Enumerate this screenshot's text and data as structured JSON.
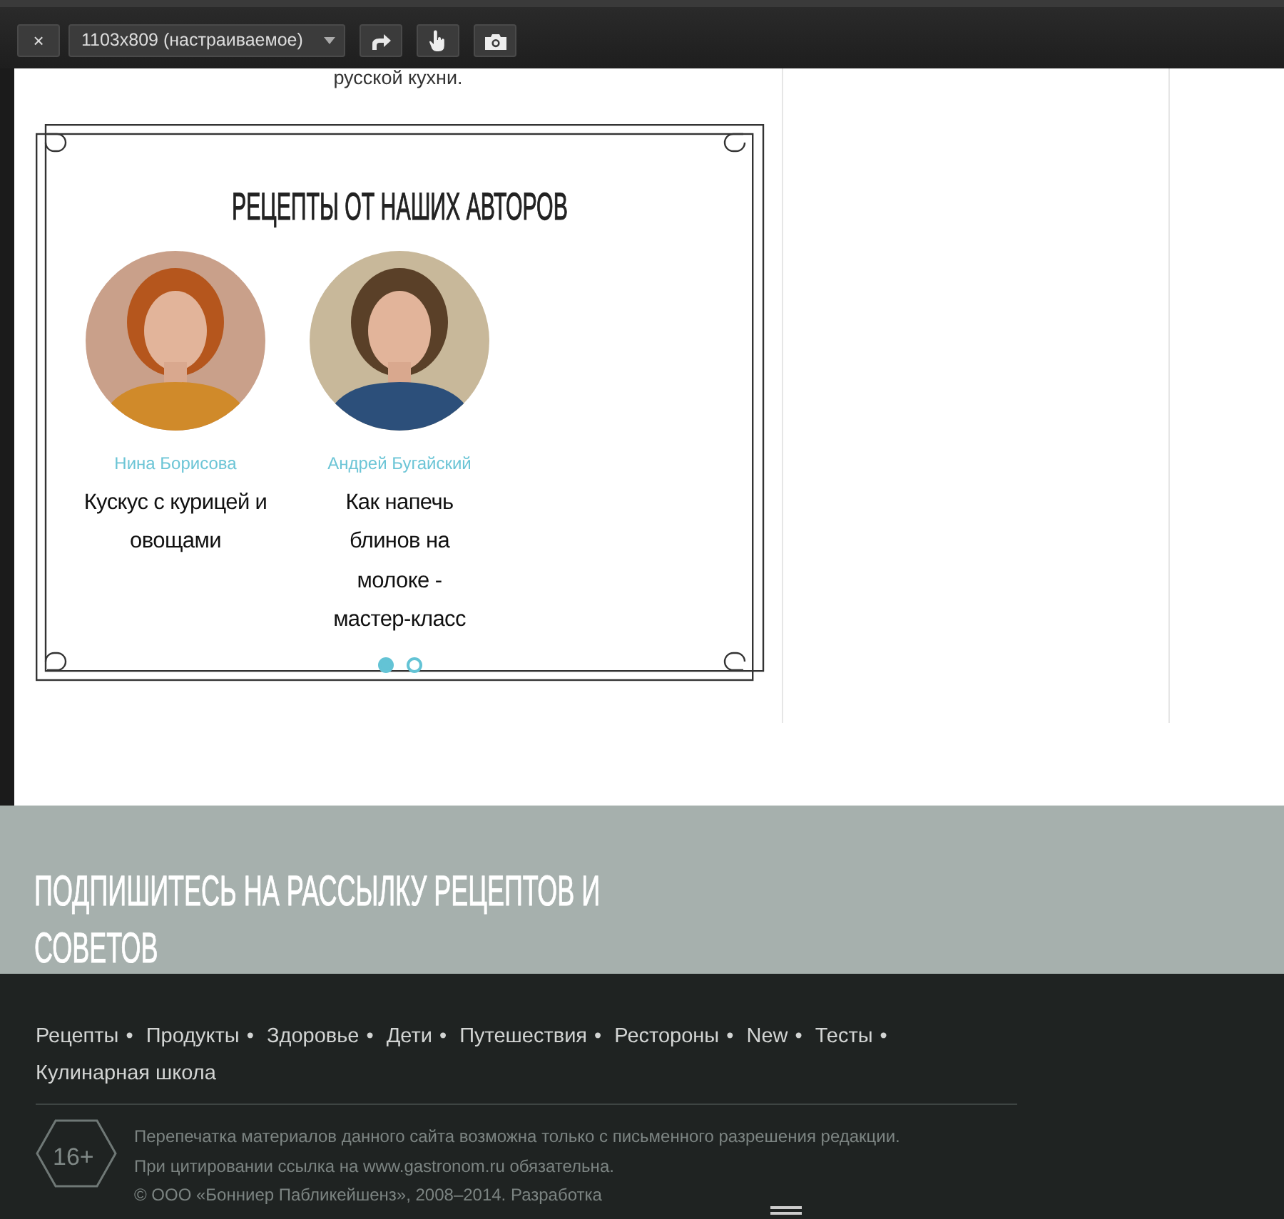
{
  "toolbar": {
    "close": "×",
    "device": "1103x809 (настраиваемое)"
  },
  "intro_text": "русской кухни.",
  "authors_block": {
    "title": "РЕЦЕПТЫ ОТ НАШИХ АВТОРОВ",
    "authors": [
      {
        "name": "Нина Борисова",
        "recipe": "Кускус с курицей и овощами"
      },
      {
        "name": "Андрей Бугайский",
        "recipe": "Как напечь блинов на молоке - мастер-класс"
      }
    ],
    "pager": [
      {
        "selected": true
      },
      {
        "selected": false
      }
    ]
  },
  "subscribe": {
    "title": "ПОДПИШИТЕСЬ НА РАССЫЛКУ РЕЦЕПТОВ И СОВЕТОВ"
  },
  "footer": {
    "links": [
      {
        "label": "Рецепты",
        "separator": "•"
      },
      {
        "label": "Продукты",
        "separator": "•"
      },
      {
        "label": "Здоровье",
        "separator": "•"
      },
      {
        "label": "Дети",
        "separator": "•"
      },
      {
        "label": "Путешествия",
        "separator": "•"
      },
      {
        "label": "Рестороны",
        "separator": "•"
      },
      {
        "label": "New",
        "separator": "•"
      },
      {
        "label": "Тесты",
        "separator": "•"
      },
      {
        "label": "Кулинарная школа"
      }
    ],
    "age_badge": "16+",
    "notes": [
      "Перепечатка материалов данного сайта возможна только с письменного разрешения редакции.",
      "При цитировании ссылка на www.gastronom.ru обязательна.",
      "© ООО «Бонниер Пабликейшенз», 2008–2014. Разработка"
    ]
  }
}
